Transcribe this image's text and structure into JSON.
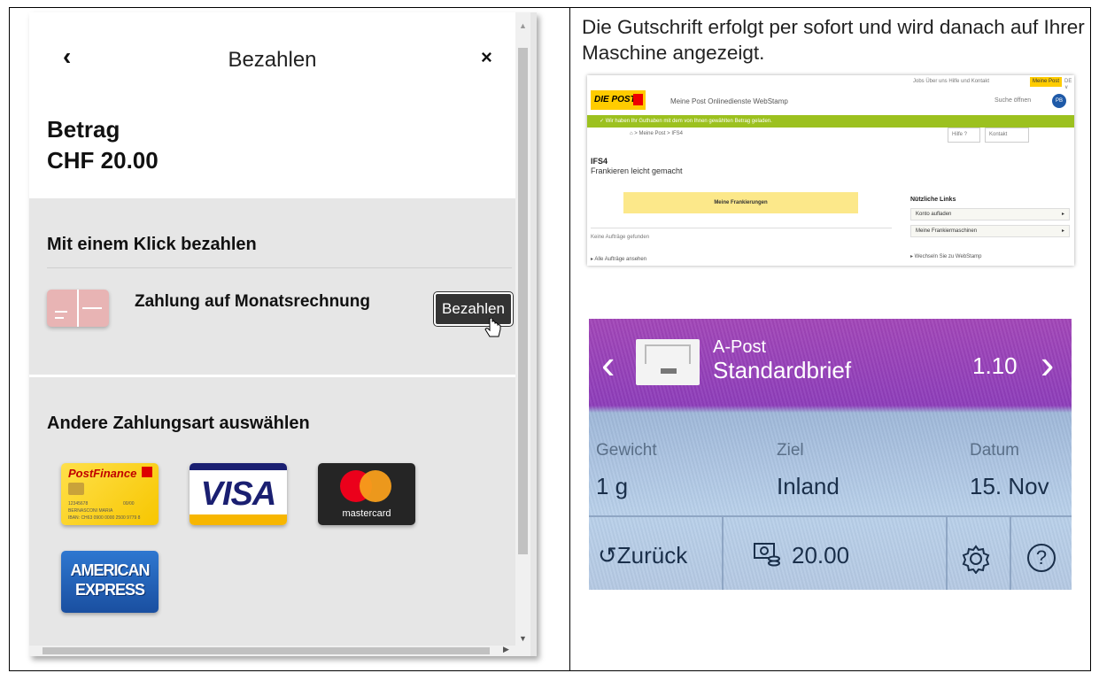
{
  "payment_dialog": {
    "title": "Bezahlen",
    "back_glyph": "‹",
    "close_glyph": "×",
    "amount_label": "Betrag",
    "amount_value": "CHF 20.00",
    "one_click_title": "Mit einem Klick bezahlen",
    "invoice_option_label": "Zahlung auf Monatsrechnung",
    "pay_button_label": "Bezahlen",
    "other_methods_title": "Andere Zahlungsart auswählen",
    "cards": {
      "postfinance": {
        "brand": "PostFinance",
        "number": "12345678",
        "holder": "BERNASCONI MARIA",
        "iban": "IBAN: CH63 0900 0000 2500 9779 8",
        "expiry": "00/00"
      },
      "visa": {
        "brand": "VISA"
      },
      "mastercard": {
        "brand": "mastercard"
      },
      "amex": {
        "line1": "AMERICAN",
        "line2": "EXPRESS"
      }
    }
  },
  "right_panel": {
    "caption": "Die Gutschrift erfolgt per sofort und wird danach auf Ihrer Maschine angezeigt.",
    "website": {
      "top_links": "Jobs   Über uns   Hilfe und Kontakt",
      "my_post_button": "Meine Post",
      "lang": "DE ∨",
      "logo": "DIE POST",
      "nav": "Meine Post    Onlinedienste    WebStamp",
      "search": "Suche öffnen",
      "avatar": "PB",
      "success_banner": "✓  Wir haben Ihr Guthaben mit dem von Ihnen gewählten Betrag geladen.",
      "breadcrumb": "⌂  >  Meine Post  >  IFS4",
      "help": "Hilfe  ?",
      "contact": "Kontakt",
      "heading": "IFS4",
      "subheading": "Frankieren leicht gemacht",
      "my_franking": "Meine Frankierungen",
      "no_orders": "Keine Aufträge gefunden",
      "all_orders": "▸  Alle Aufträge ansehen",
      "useful_links": "Nützliche Links",
      "links": [
        {
          "label": "Konto aufladen",
          "arrow": "▸"
        },
        {
          "label": "Meine Frankiermaschinen",
          "arrow": "▸"
        }
      ],
      "webstamp_link": "▸  Wechseln Sie zu WebStamp"
    },
    "machine": {
      "prev_glyph": "‹",
      "next_glyph": "›",
      "service": "A-Post",
      "product": "Standardbrief",
      "price": "1.10",
      "weight_label": "Gewicht",
      "weight_value": "1 g",
      "destination_label": "Ziel",
      "destination_value": "Inland",
      "date_label": "Datum",
      "date_value": "15. Nov",
      "back_label": "↺Zurück",
      "credit_value": "20.00",
      "help_glyph": "?"
    }
  },
  "colors": {
    "post_yellow": "#ffcc00",
    "success_green": "#9cc11f",
    "machine_purple": "#8d3dba",
    "pay_button": "#333333"
  }
}
